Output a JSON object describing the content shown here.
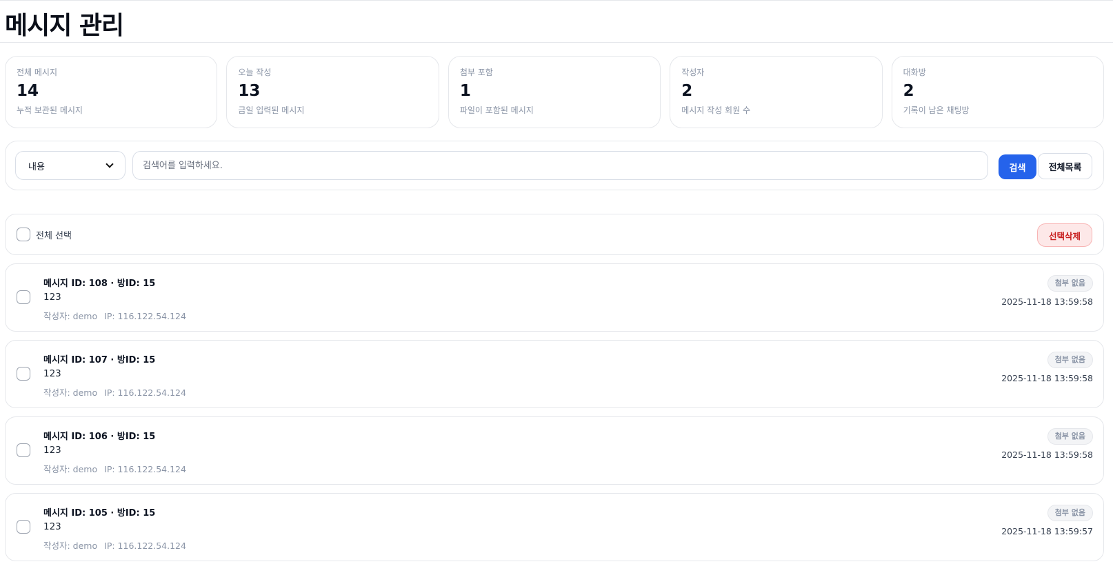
{
  "page": {
    "title": "메시지 관리"
  },
  "stats": [
    {
      "label": "전체 메시지",
      "value": "14",
      "desc": "누적 보관된 메시지"
    },
    {
      "label": "오늘 작성",
      "value": "13",
      "desc": "금일 입력된 메시지"
    },
    {
      "label": "첨부 포함",
      "value": "1",
      "desc": "파일이 포함된 메시지"
    },
    {
      "label": "작성자",
      "value": "2",
      "desc": "메시지 작성 회원 수"
    },
    {
      "label": "대화방",
      "value": "2",
      "desc": "기록이 남은 채팅방"
    }
  ],
  "search": {
    "field_selected": "내용",
    "placeholder": "검색어를 입력하세요.",
    "value": "",
    "search_label": "검색",
    "all_label": "전체목록"
  },
  "bulk": {
    "select_all_label": "전체 선택",
    "delete_label": "선택삭제"
  },
  "messages": [
    {
      "title": "메시지 ID: 108 · 방ID: 15",
      "body": "123",
      "author": "작성자: demo",
      "ip": "IP: 116.122.54.124",
      "badge": "첨부 없음",
      "date": "2025-11-18 13:59:58"
    },
    {
      "title": "메시지 ID: 107 · 방ID: 15",
      "body": "123",
      "author": "작성자: demo",
      "ip": "IP: 116.122.54.124",
      "badge": "첨부 없음",
      "date": "2025-11-18 13:59:58"
    },
    {
      "title": "메시지 ID: 106 · 방ID: 15",
      "body": "123",
      "author": "작성자: demo",
      "ip": "IP: 116.122.54.124",
      "badge": "첨부 없음",
      "date": "2025-11-18 13:59:58"
    },
    {
      "title": "메시지 ID: 105 · 방ID: 15",
      "body": "123",
      "author": "작성자: demo",
      "ip": "IP: 116.122.54.124",
      "badge": "첨부 없음",
      "date": "2025-11-18 13:59:57"
    }
  ],
  "colors": {
    "primary": "#2563eb",
    "danger": "#c81e1e",
    "danger_bg": "#fde8e8",
    "muted_text": "#8a94a6",
    "border": "#e5e7eb"
  }
}
